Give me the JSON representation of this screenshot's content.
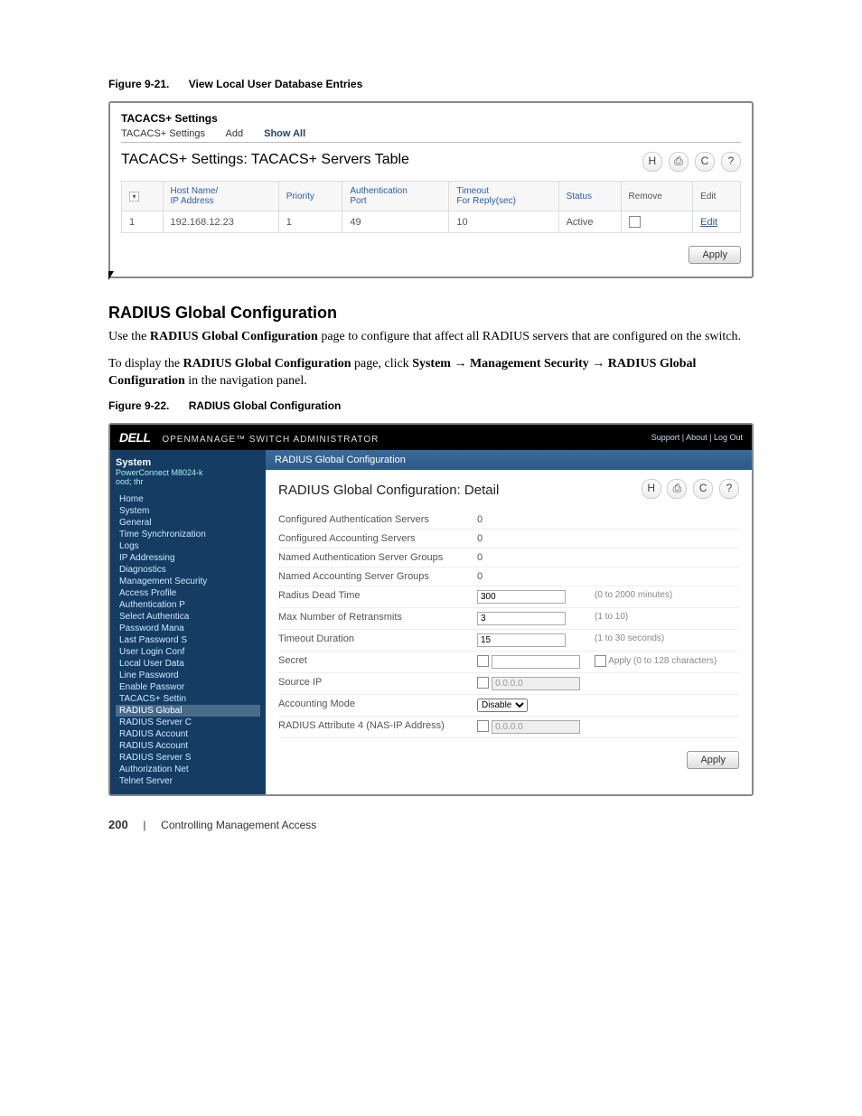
{
  "fig1": {
    "num": "Figure 9-21.",
    "title": "View Local User Database Entries",
    "crumb": "TACACS+ Settings",
    "tabs": {
      "t1": "TACACS+ Settings",
      "t2": "Add",
      "t3": "Show All"
    },
    "panel_title": "TACACS+ Settings: TACACS+ Servers Table",
    "headers": {
      "idx": "",
      "host": "Host Name/\nIP Address",
      "prio": "Priority",
      "auth": "Authentication\nPort",
      "timeout": "Timeout\nFor Reply(sec)",
      "status": "Status",
      "remove": "Remove",
      "edit": "Edit"
    },
    "row": {
      "idx": "1",
      "host": "192.168.12.23",
      "prio": "1",
      "auth": "49",
      "timeout": "10",
      "status": "Active",
      "edit": "Edit"
    },
    "apply": "Apply"
  },
  "section": {
    "heading": "RADIUS Global Configuration",
    "p1a": "Use the ",
    "p1b": "RADIUS Global Configuration",
    "p1c": " page to configure that affect all RADIUS servers that are configured on the switch.",
    "p2a": "To display the ",
    "p2b": "RADIUS Global Configuration",
    "p2c": " page, click ",
    "p2d": "System",
    "p2e": " → ",
    "p2f": "Management Security",
    "p2g": " → ",
    "p2h": "RADIUS Global Configuration",
    "p2i": " in the navigation panel."
  },
  "fig2": {
    "num": "Figure 9-22.",
    "title": "RADIUS Global Configuration",
    "brand": "DELL",
    "brandsub": "OPENMANAGE™ SWITCH ADMINISTRATOR",
    "toplinks": "Support  |  About  |  Log Out",
    "sidebar": {
      "head": "System",
      "sub": "PowerConnect M8024-k\nood; thr",
      "items": [
        "Home",
        "System",
        "General",
        "Time Synchronization",
        "Logs",
        "IP Addressing",
        "Diagnostics",
        "Management Security",
        "Access Profile",
        "Authentication P",
        "Select Authentica",
        "Password Mana",
        "Last Password S",
        "User Login Conf",
        "Local User Data",
        "Line Password",
        "Enable Passwor",
        "TACACS+ Settin",
        "RADIUS Global",
        "RADIUS Server C",
        "RADIUS Account",
        "RADIUS Account",
        "RADIUS Server S",
        "Authorization Net",
        "Telnet Server"
      ],
      "selected_index": 18
    },
    "crumb": "RADIUS Global Configuration",
    "panel_title": "RADIUS Global Configuration: Detail",
    "rows": [
      {
        "lab": "Configured Authentication Servers",
        "val": "0",
        "hint": ""
      },
      {
        "lab": "Configured Accounting Servers",
        "val": "0",
        "hint": ""
      },
      {
        "lab": "Named Authentication Server Groups",
        "val": "0",
        "hint": ""
      },
      {
        "lab": "Named Accounting Server Groups",
        "val": "0",
        "hint": ""
      },
      {
        "lab": "Radius Dead Time",
        "val": "300",
        "hint": "(0 to 2000 minutes)",
        "input": true
      },
      {
        "lab": "Max Number of Retransmits",
        "val": "3",
        "hint": "(1 to 10)",
        "input": true
      },
      {
        "lab": "Timeout Duration",
        "val": "15",
        "hint": "(1 to 30 seconds)",
        "input": true
      },
      {
        "lab": "Secret",
        "val": "",
        "hint": "Apply  (0 to 128 characters)",
        "input": true,
        "check": true
      },
      {
        "lab": "Source IP",
        "val": "0.0.0.0",
        "hint": "",
        "input": true,
        "grey": true,
        "check": true
      },
      {
        "lab": "Accounting Mode",
        "val": "Disable",
        "hint": "",
        "select": true
      },
      {
        "lab": "RADIUS Attribute 4 (NAS-IP Address)",
        "val": "0.0.0.0",
        "hint": "",
        "input": true,
        "grey": true,
        "check": true
      }
    ],
    "apply": "Apply"
  },
  "footer": {
    "page": "200",
    "sep": "|",
    "chapter": "Controlling Management Access"
  }
}
